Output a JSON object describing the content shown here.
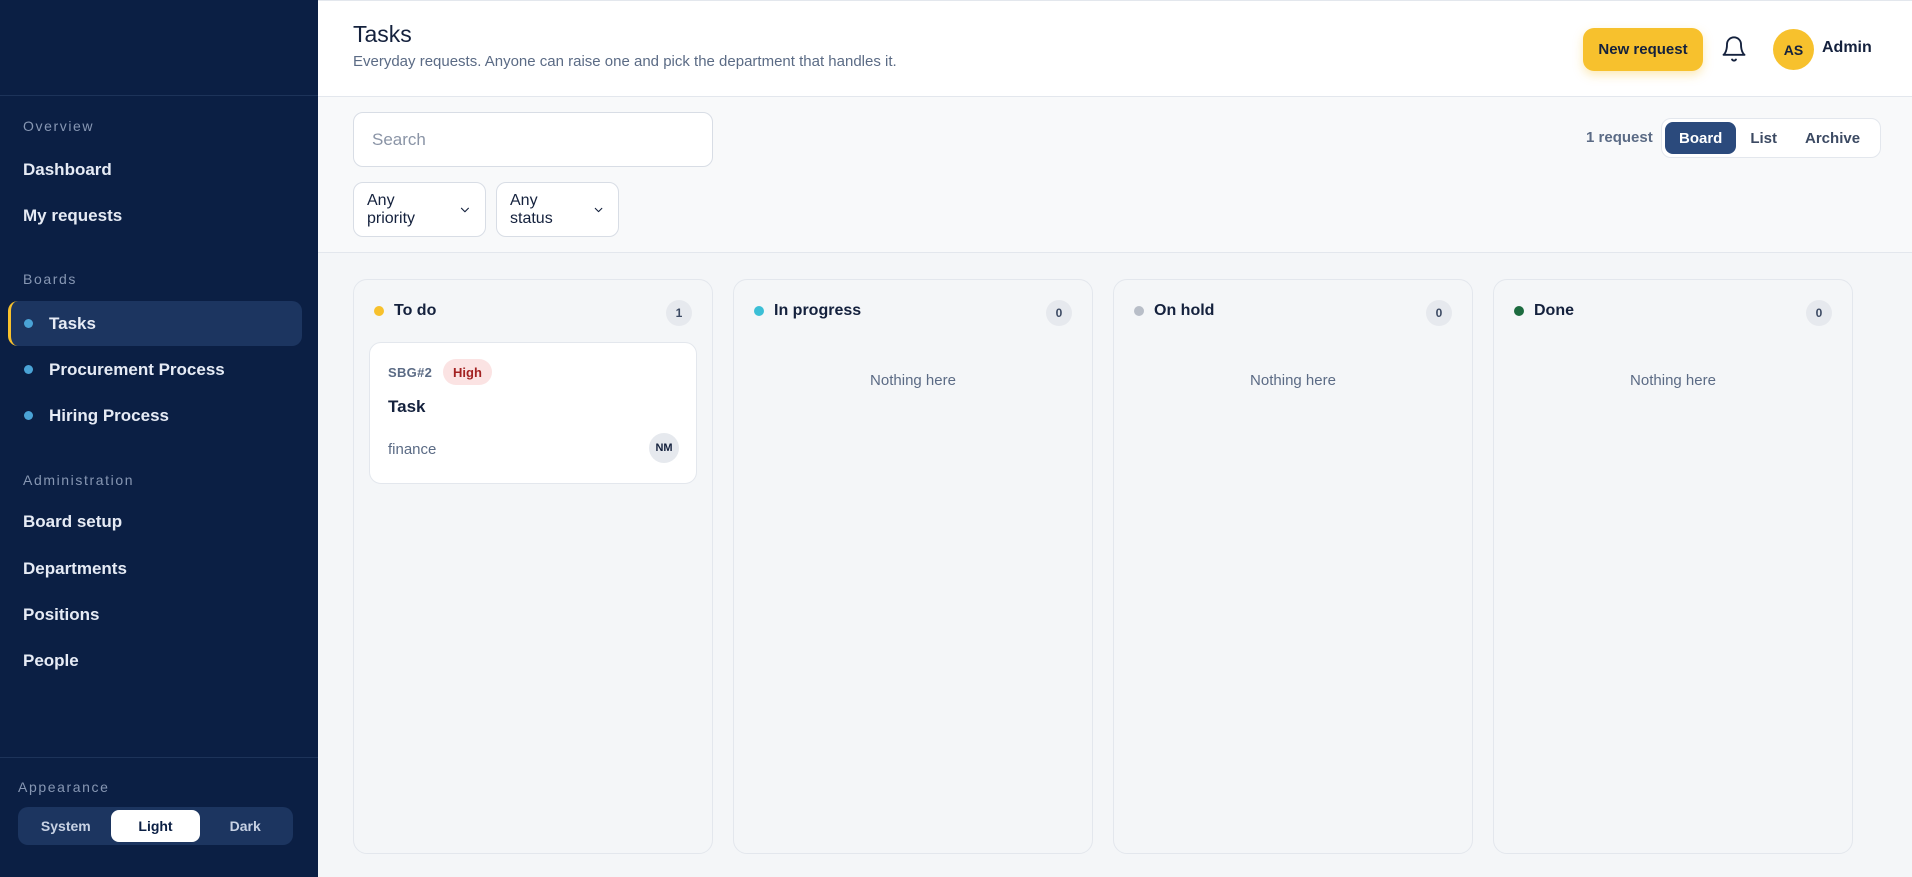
{
  "sidebar": {
    "overview_label": "Overview",
    "overview_items": [
      {
        "label": "Dashboard"
      },
      {
        "label": "My requests"
      }
    ],
    "boards_label": "Boards",
    "boards": [
      {
        "label": "Tasks",
        "active": true
      },
      {
        "label": "Procurement Process",
        "active": false
      },
      {
        "label": "Hiring Process",
        "active": false
      }
    ],
    "admin_label": "Administration",
    "admin_items": [
      {
        "label": "Board setup"
      },
      {
        "label": "Departments"
      },
      {
        "label": "Positions"
      },
      {
        "label": "People"
      }
    ],
    "appearance": {
      "label": "Appearance",
      "options": [
        "System",
        "Light",
        "Dark"
      ],
      "selected": "Light"
    }
  },
  "header": {
    "title": "Tasks",
    "subtitle": "Everyday requests. Anyone can raise one and pick the department that handles it.",
    "new_request_label": "New request",
    "user_initials": "AS",
    "user_name": "Admin"
  },
  "toolbar": {
    "search_placeholder": "Search",
    "priority_filter": "Any priority",
    "status_filter": "Any status",
    "request_count": "1 request",
    "views": [
      "Board",
      "List",
      "Archive"
    ],
    "selected_view": "Board"
  },
  "board": {
    "columns": [
      {
        "title": "To do",
        "count": "1",
        "dot_color": "#f7c12d",
        "empty_text": ""
      },
      {
        "title": "In progress",
        "count": "0",
        "dot_color": "#3bbfd6",
        "empty_text": "Nothing here"
      },
      {
        "title": "On hold",
        "count": "0",
        "dot_color": "#b8bec8",
        "empty_text": "Nothing here"
      },
      {
        "title": "Done",
        "count": "0",
        "dot_color": "#1c6b3f",
        "empty_text": "Nothing here"
      }
    ],
    "card": {
      "key": "SBG#2",
      "priority": "High",
      "title": "Task",
      "department": "finance",
      "assignee_initials": "NM"
    }
  },
  "colors": {
    "sidebar_bg": "#0b1f44",
    "accent": "#f7c12d",
    "active_view": "#2b4a7c",
    "priority_high_bg": "#fbe3e3",
    "priority_high_text": "#a32222"
  },
  "icons": {
    "bell": "bell-icon",
    "chevron": "chevron-down-icon"
  }
}
